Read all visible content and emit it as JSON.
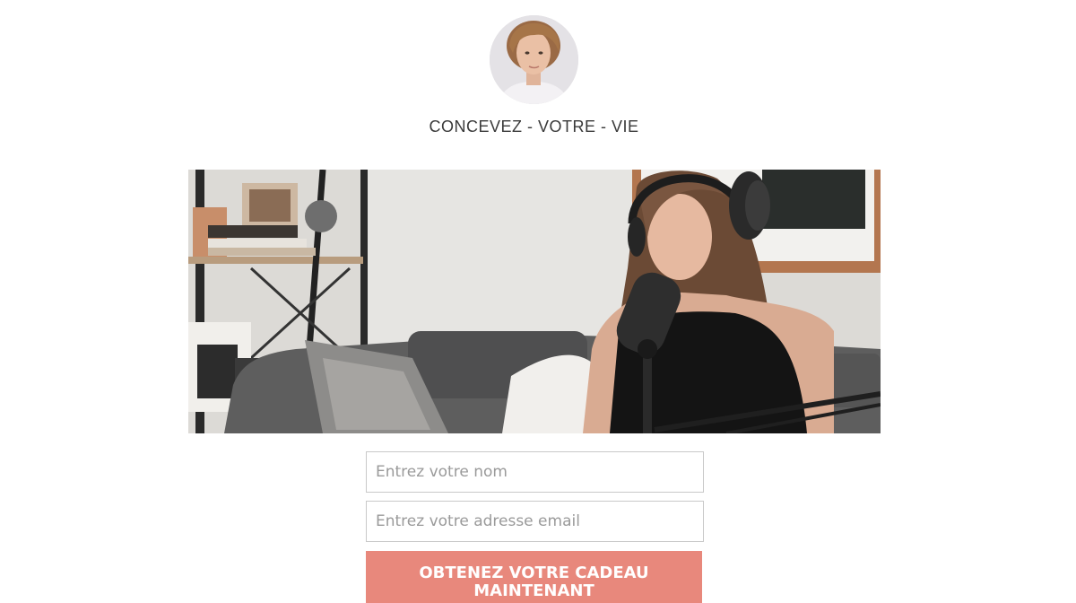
{
  "header": {
    "avatar_icon": "person-avatar",
    "tagline": "CONCEVEZ - VOTRE - VIE"
  },
  "hero": {
    "image_subject": "woman-podcasting-microphone"
  },
  "form": {
    "name_placeholder": "Entrez votre nom",
    "email_placeholder": "Entrez votre adresse email",
    "submit_label": "OBTENEZ VOTRE CADEAU MAINTENANT"
  },
  "colors": {
    "accent": "#e8887c",
    "text": "#3a3a3a",
    "field_border": "#c9c9c9"
  }
}
